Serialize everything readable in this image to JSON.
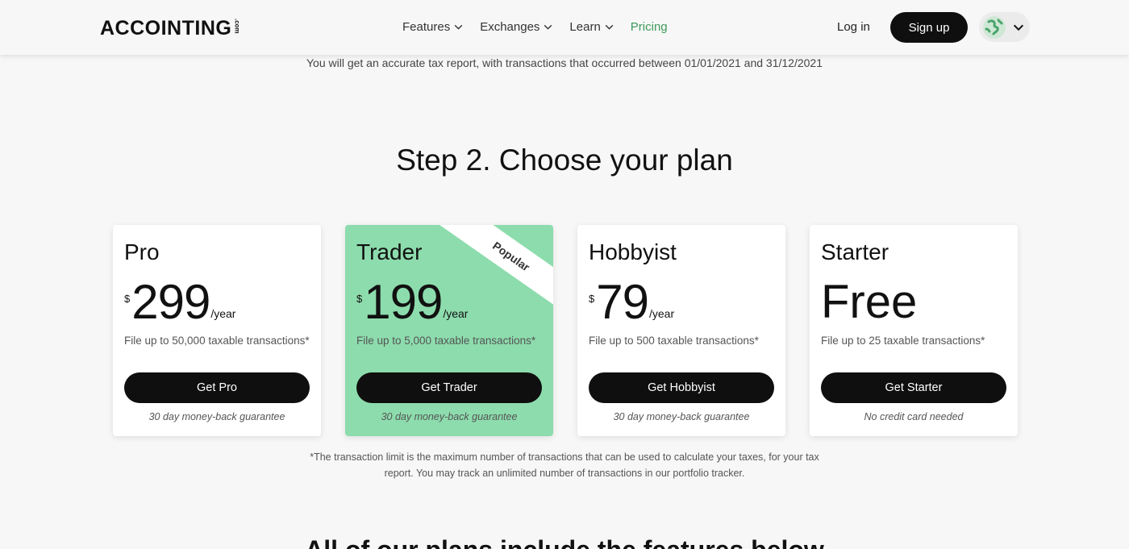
{
  "header": {
    "logo": "ACCOINTING",
    "logo_suffix": ".com",
    "nav": [
      {
        "label": "Features"
      },
      {
        "label": "Exchanges"
      },
      {
        "label": "Learn"
      },
      {
        "label": "Pricing"
      }
    ],
    "login": "Log in",
    "signup": "Sign up"
  },
  "intro": "You will get an accurate tax report, with transactions that occurred between 01/01/2021 and 31/12/2021",
  "step_title": "Step 2. Choose your plan",
  "plans": [
    {
      "name": "Pro",
      "currency": "$",
      "price": "299",
      "period": "/year",
      "desc": "File up to 50,000 taxable transactions*",
      "cta": "Get Pro",
      "note": "30 day money-back guarantee"
    },
    {
      "name": "Trader",
      "currency": "$",
      "price": "199",
      "period": "/year",
      "desc": "File up to 5,000 taxable transactions*",
      "cta": "Get Trader",
      "note": "30 day money-back guarantee",
      "badge": "Popular"
    },
    {
      "name": "Hobbyist",
      "currency": "$",
      "price": "79",
      "period": "/year",
      "desc": "File up to 500 taxable transactions*",
      "cta": "Get Hobbyist",
      "note": "30 day money-back guarantee"
    },
    {
      "name": "Starter",
      "price": "Free",
      "desc": "File up to 25 taxable transactions*",
      "cta": "Get Starter",
      "note": "No credit card needed"
    }
  ],
  "footnote": {
    "line1": "*The transaction limit is the maximum number of transactions that can be used to calculate your taxes, for your tax",
    "line2": "report. You may track an unlimited number of transactions in our portfolio tracker."
  },
  "next_title": "All of our plans include the features below",
  "colors": {
    "accent_green": "#3d9a5a",
    "trader_card": "#8ddcad",
    "button": "#0f0f0f",
    "background": "#f7f7f7"
  },
  "icons": [
    "chevron-down-icon",
    "globe-icon"
  ]
}
